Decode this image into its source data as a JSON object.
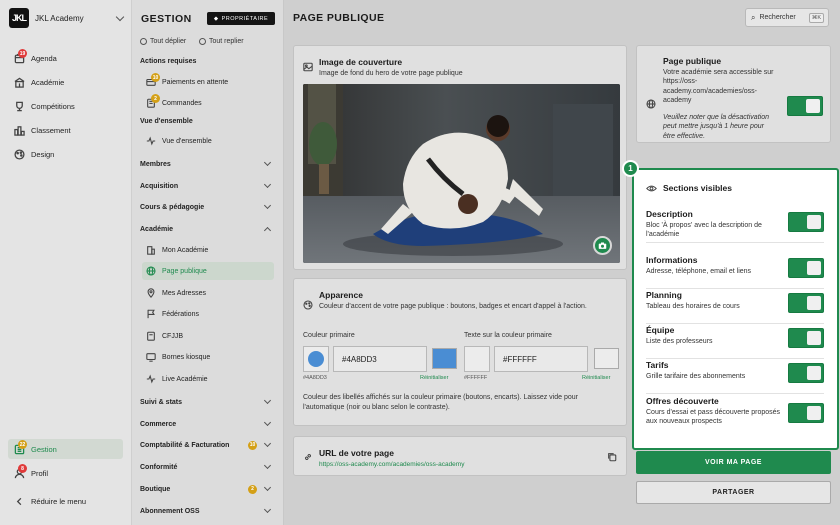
{
  "rail": {
    "academy_logo": "JKL",
    "academy_name": "JKL Academy",
    "items": [
      {
        "label": "Agenda",
        "badge": "19",
        "icon": "calendar-icon"
      },
      {
        "label": "Académie",
        "icon": "building-icon"
      },
      {
        "label": "Compétitions",
        "icon": "trophy-icon"
      },
      {
        "label": "Classement",
        "icon": "ranking-icon"
      },
      {
        "label": "Design",
        "icon": "palette-icon"
      }
    ],
    "bottom": [
      {
        "label": "Gestion",
        "badge": "22",
        "icon": "gestion-icon"
      },
      {
        "label": "Profil",
        "badge": "8",
        "icon": "user-icon"
      },
      {
        "label": "Réduire le menu",
        "icon": "chevron-left-icon"
      }
    ]
  },
  "mid": {
    "title": "GESTION",
    "owner_badge": "PROPRIÉTAIRE",
    "expand_all": "Tout déplier",
    "collapse_all": "Tout replier",
    "actions_header": "Actions requises",
    "actions": [
      {
        "label": "Paiements en attente",
        "badge": "10"
      },
      {
        "label": "Commandes",
        "badge": "2"
      }
    ],
    "overview_header": "Vue d'ensemble",
    "overview_item": "Vue d'ensemble",
    "groups_before": [
      "Membres",
      "Acquisition",
      "Cours & pédagogie"
    ],
    "academie_group": "Académie",
    "academie_items": [
      "Mon Académie",
      "Page publique",
      "Mes Adresses",
      "Fédérations",
      "CFJJB",
      "Bornes kiosque",
      "Live Académie"
    ],
    "groups_after": [
      {
        "label": "Suivi & stats"
      },
      {
        "label": "Commerce"
      },
      {
        "label": "Comptabilité & Facturation",
        "badge": "10"
      },
      {
        "label": "Conformité"
      },
      {
        "label": "Boutique",
        "badge": "2"
      },
      {
        "label": "Abonnement OSS"
      }
    ]
  },
  "main": {
    "title": "PAGE PUBLIQUE",
    "search_label": "Rechercher",
    "search_kbd": "⌘K",
    "cover": {
      "title": "Image de couverture",
      "subtitle": "Image de fond du hero de votre page publique"
    },
    "appearance": {
      "title": "Apparence",
      "subtitle": "Couleur d'accent de votre page publique : boutons, badges et encart d'appel à l'action.",
      "primary_label": "Couleur primaire",
      "primary_value": "#4A8DD3",
      "primary_caption": "#4A8DD3",
      "text_label": "Texte sur la couleur primaire",
      "text_value": "#FFFFFF",
      "text_caption": "#FFFFFF",
      "reset_label": "Réinitialiser",
      "help": "Couleur des libellés affichés sur la couleur primaire (boutons, encarts). Laissez vide pour l'automatique (noir ou blanc selon le contraste)."
    },
    "url": {
      "title": "URL de votre page",
      "value": "https://oss-academy.com/academies/oss-academy"
    },
    "public_page": {
      "title": "Page publique",
      "text": "Votre académie sera accessible sur https://oss-academy.com/academies/oss-academy",
      "note": "Veuillez noter que la désactivation peut mettre jusqu'à 1 heure pour être effective.",
      "enabled": true
    },
    "step_number": "1",
    "sections": {
      "title": "Sections visibles",
      "rows": [
        {
          "title": "Description",
          "desc": "Bloc 'À propos' avec la description de l'académie",
          "enabled": true
        },
        {
          "title": "Informations",
          "desc": "Adresse, téléphone, email et liens",
          "enabled": true
        },
        {
          "title": "Planning",
          "desc": "Tableau des horaires de cours",
          "enabled": true
        },
        {
          "title": "Équipe",
          "desc": "Liste des professeurs",
          "enabled": true
        },
        {
          "title": "Tarifs",
          "desc": "Grille tarifaire des abonnements",
          "enabled": true
        },
        {
          "title": "Offres découverte",
          "desc": "Cours d'essai et pass découverte proposés aux nouveaux prospects",
          "enabled": true
        }
      ]
    },
    "view_button": "VOIR MA PAGE",
    "share_button": "PARTAGER"
  },
  "colors": {
    "accent": "#1F8A4E",
    "primary": "#4A8DD3",
    "text_on_primary": "#FFFFFF"
  }
}
